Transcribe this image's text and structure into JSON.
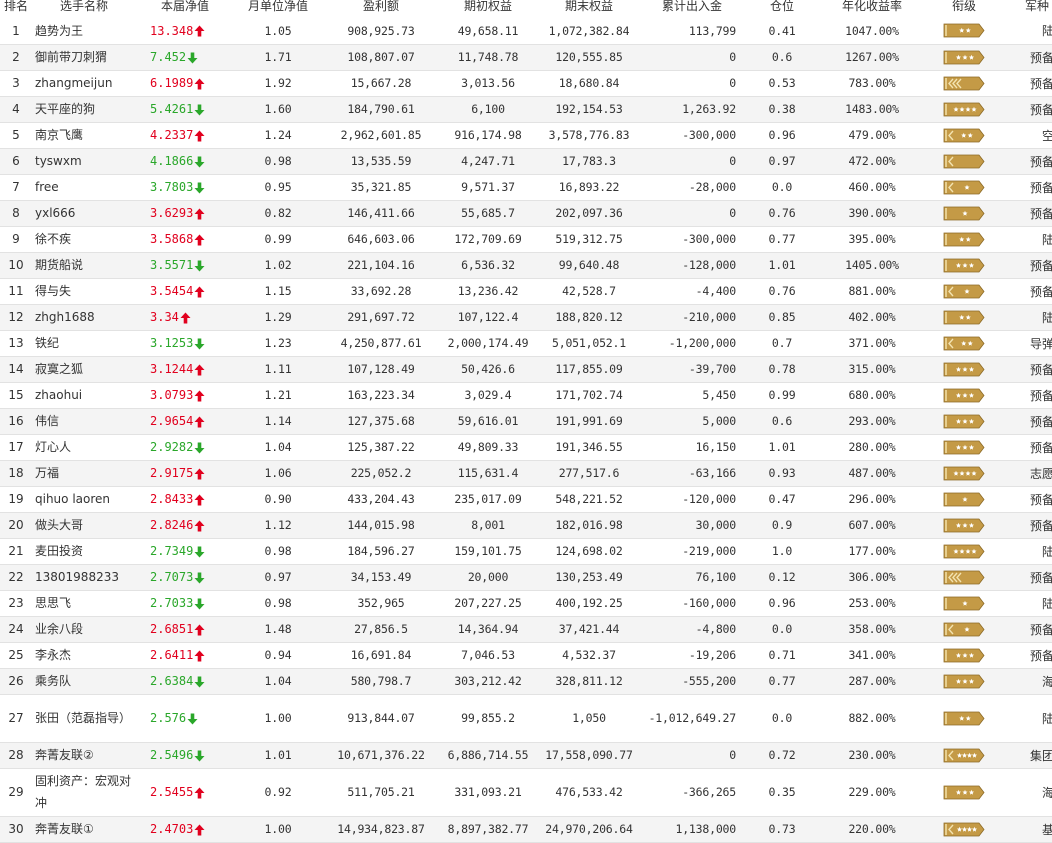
{
  "headers": [
    "排名",
    "选手名称",
    "本届净值",
    "月单位净值",
    "盈利额",
    "期初权益",
    "期末权益",
    "累计出入金",
    "仓位",
    "年化收益率",
    "衔级",
    "军种"
  ],
  "colors": {
    "up": "#e1001e",
    "down": "#2aa72a",
    "badge_fill": "#c49a46",
    "badge_stripe": "#f3e3b0"
  },
  "rows": [
    {
      "rank": "1",
      "name": "趋势为王",
      "net": "13.348",
      "dir": "up",
      "monthly": "1.05",
      "profit": "908,925.73",
      "start": "49,658.11",
      "end": "1,072,382.84",
      "flow": "113,799",
      "position": "0.41",
      "annual": "1047.00%",
      "badge": {
        "style": "stars",
        "count": 2
      },
      "branch": "陆军"
    },
    {
      "rank": "2",
      "name": "御前带刀刺猬",
      "net": "7.452",
      "dir": "down",
      "monthly": "1.71",
      "profit": "108,807.07",
      "start": "11,748.78",
      "end": "120,555.85",
      "flow": "0",
      "position": "0.6",
      "annual": "1267.00%",
      "badge": {
        "style": "stars",
        "count": 3
      },
      "branch": "预备役"
    },
    {
      "rank": "3",
      "name": "zhangmeijun",
      "net": "6.1989",
      "dir": "up",
      "monthly": "1.92",
      "profit": "15,667.28",
      "start": "3,013.56",
      "end": "18,680.84",
      "flow": "0",
      "position": "0.53",
      "annual": "783.00%",
      "badge": {
        "style": "chevrons",
        "count": 3
      },
      "branch": "预备役"
    },
    {
      "rank": "4",
      "name": "天平座的狗",
      "net": "5.4261",
      "dir": "down",
      "monthly": "1.60",
      "profit": "184,790.61",
      "start": "6,100",
      "end": "192,154.53",
      "flow": "1,263.92",
      "position": "0.38",
      "annual": "1483.00%",
      "badge": {
        "style": "stars",
        "count": 4
      },
      "branch": "预备役"
    },
    {
      "rank": "5",
      "name": "南京飞鹰",
      "net": "4.2337",
      "dir": "up",
      "monthly": "1.24",
      "profit": "2,962,601.85",
      "start": "916,174.98",
      "end": "3,578,776.83",
      "flow": "-300,000",
      "position": "0.96",
      "annual": "479.00%",
      "badge": {
        "style": "chevron-stars",
        "count": 2
      },
      "branch": "空军"
    },
    {
      "rank": "6",
      "name": "tyswxm",
      "net": "4.1866",
      "dir": "down",
      "monthly": "0.98",
      "profit": "13,535.59",
      "start": "4,247.71",
      "end": "17,783.3",
      "flow": "0",
      "position": "0.97",
      "annual": "472.00%",
      "badge": {
        "style": "chevrons",
        "count": 1
      },
      "branch": "预备役"
    },
    {
      "rank": "7",
      "name": "free",
      "net": "3.7803",
      "dir": "down",
      "monthly": "0.95",
      "profit": "35,321.85",
      "start": "9,571.37",
      "end": "16,893.22",
      "flow": "-28,000",
      "position": "0.0",
      "annual": "460.00%",
      "badge": {
        "style": "chevron-stars",
        "count": 1
      },
      "branch": "预备役"
    },
    {
      "rank": "8",
      "name": "yxl666",
      "net": "3.6293",
      "dir": "up",
      "monthly": "0.82",
      "profit": "146,411.66",
      "start": "55,685.7",
      "end": "202,097.36",
      "flow": "0",
      "position": "0.76",
      "annual": "390.00%",
      "badge": {
        "style": "stars",
        "count": 1
      },
      "branch": "预备役"
    },
    {
      "rank": "9",
      "name": "徐不疾",
      "net": "3.5868",
      "dir": "up",
      "monthly": "0.99",
      "profit": "646,603.06",
      "start": "172,709.69",
      "end": "519,312.75",
      "flow": "-300,000",
      "position": "0.77",
      "annual": "395.00%",
      "badge": {
        "style": "stars",
        "count": 2
      },
      "branch": "陆军"
    },
    {
      "rank": "10",
      "name": "期货船说",
      "net": "3.5571",
      "dir": "down",
      "monthly": "1.02",
      "profit": "221,104.16",
      "start": "6,536.32",
      "end": "99,640.48",
      "flow": "-128,000",
      "position": "1.01",
      "annual": "1405.00%",
      "badge": {
        "style": "stars",
        "count": 3
      },
      "branch": "预备役"
    },
    {
      "rank": "11",
      "name": "得与失",
      "net": "3.5454",
      "dir": "up",
      "monthly": "1.15",
      "profit": "33,692.28",
      "start": "13,236.42",
      "end": "42,528.7",
      "flow": "-4,400",
      "position": "0.76",
      "annual": "881.00%",
      "badge": {
        "style": "chevron-stars",
        "count": 1
      },
      "branch": "预备役"
    },
    {
      "rank": "12",
      "name": "zhgh1688",
      "net": "3.34",
      "dir": "up",
      "monthly": "1.29",
      "profit": "291,697.72",
      "start": "107,122.4",
      "end": "188,820.12",
      "flow": "-210,000",
      "position": "0.85",
      "annual": "402.00%",
      "badge": {
        "style": "stars",
        "count": 2
      },
      "branch": "陆军"
    },
    {
      "rank": "13",
      "name": "铁纪",
      "net": "3.1253",
      "dir": "down",
      "monthly": "1.23",
      "profit": "4,250,877.61",
      "start": "2,000,174.49",
      "end": "5,051,052.1",
      "flow": "-1,200,000",
      "position": "0.7",
      "annual": "371.00%",
      "badge": {
        "style": "chevron-stars",
        "count": 2
      },
      "branch": "导弹部"
    },
    {
      "rank": "14",
      "name": "寂寞之狐",
      "net": "3.1244",
      "dir": "up",
      "monthly": "1.11",
      "profit": "107,128.49",
      "start": "50,426.6",
      "end": "117,855.09",
      "flow": "-39,700",
      "position": "0.78",
      "annual": "315.00%",
      "badge": {
        "style": "stars",
        "count": 3
      },
      "branch": "预备役"
    },
    {
      "rank": "15",
      "name": "zhaohui",
      "net": "3.0793",
      "dir": "up",
      "monthly": "1.21",
      "profit": "163,223.34",
      "start": "3,029.4",
      "end": "171,702.74",
      "flow": "5,450",
      "position": "0.99",
      "annual": "680.00%",
      "badge": {
        "style": "stars",
        "count": 3
      },
      "branch": "预备役"
    },
    {
      "rank": "16",
      "name": "伟信",
      "net": "2.9654",
      "dir": "up",
      "monthly": "1.14",
      "profit": "127,375.68",
      "start": "59,616.01",
      "end": "191,991.69",
      "flow": "5,000",
      "position": "0.6",
      "annual": "293.00%",
      "badge": {
        "style": "stars",
        "count": 3
      },
      "branch": "预备役"
    },
    {
      "rank": "17",
      "name": "灯心人",
      "net": "2.9282",
      "dir": "down",
      "monthly": "1.04",
      "profit": "125,387.22",
      "start": "49,809.33",
      "end": "191,346.55",
      "flow": "16,150",
      "position": "1.01",
      "annual": "280.00%",
      "badge": {
        "style": "stars",
        "count": 3
      },
      "branch": "预备役"
    },
    {
      "rank": "18",
      "name": "万福",
      "net": "2.9175",
      "dir": "up",
      "monthly": "1.06",
      "profit": "225,052.2",
      "start": "115,631.4",
      "end": "277,517.6",
      "flow": "-63,166",
      "position": "0.93",
      "annual": "487.00%",
      "badge": {
        "style": "stars",
        "count": 4
      },
      "branch": "志愿军"
    },
    {
      "rank": "19",
      "name": "qihuo laoren",
      "net": "2.8433",
      "dir": "up",
      "monthly": "0.90",
      "profit": "433,204.43",
      "start": "235,017.09",
      "end": "548,221.52",
      "flow": "-120,000",
      "position": "0.47",
      "annual": "296.00%",
      "badge": {
        "style": "stars",
        "count": 1
      },
      "branch": "预备役"
    },
    {
      "rank": "20",
      "name": "做头大哥",
      "net": "2.8246",
      "dir": "up",
      "monthly": "1.12",
      "profit": "144,015.98",
      "start": "8,001",
      "end": "182,016.98",
      "flow": "30,000",
      "position": "0.9",
      "annual": "607.00%",
      "badge": {
        "style": "stars",
        "count": 3
      },
      "branch": "预备役"
    },
    {
      "rank": "21",
      "name": "麦田投资",
      "net": "2.7349",
      "dir": "down",
      "monthly": "0.98",
      "profit": "184,596.27",
      "start": "159,101.75",
      "end": "124,698.02",
      "flow": "-219,000",
      "position": "1.0",
      "annual": "177.00%",
      "badge": {
        "style": "stars",
        "count": 4
      },
      "branch": "陆军"
    },
    {
      "rank": "22",
      "name": "13801988233",
      "net": "2.7073",
      "dir": "down",
      "monthly": "0.97",
      "profit": "34,153.49",
      "start": "20,000",
      "end": "130,253.49",
      "flow": "76,100",
      "position": "0.12",
      "annual": "306.00%",
      "badge": {
        "style": "chevrons",
        "count": 3
      },
      "branch": "预备役"
    },
    {
      "rank": "23",
      "name": "思思飞",
      "net": "2.7033",
      "dir": "down",
      "monthly": "0.98",
      "profit": "352,965",
      "start": "207,227.25",
      "end": "400,192.25",
      "flow": "-160,000",
      "position": "0.96",
      "annual": "253.00%",
      "badge": {
        "style": "stars",
        "count": 1
      },
      "branch": "陆军"
    },
    {
      "rank": "24",
      "name": "业余八段",
      "net": "2.6851",
      "dir": "up",
      "monthly": "1.48",
      "profit": "27,856.5",
      "start": "14,364.94",
      "end": "37,421.44",
      "flow": "-4,800",
      "position": "0.0",
      "annual": "358.00%",
      "badge": {
        "style": "chevron-stars",
        "count": 1
      },
      "branch": "预备役"
    },
    {
      "rank": "25",
      "name": "李永杰",
      "net": "2.6411",
      "dir": "up",
      "monthly": "0.94",
      "profit": "16,691.84",
      "start": "7,046.53",
      "end": "4,532.37",
      "flow": "-19,206",
      "position": "0.71",
      "annual": "341.00%",
      "badge": {
        "style": "stars",
        "count": 3
      },
      "branch": "预备役"
    },
    {
      "rank": "26",
      "name": "乘务队",
      "net": "2.6384",
      "dir": "down",
      "monthly": "1.04",
      "profit": "580,798.7",
      "start": "303,212.42",
      "end": "328,811.12",
      "flow": "-555,200",
      "position": "0.77",
      "annual": "287.00%",
      "badge": {
        "style": "stars",
        "count": 3
      },
      "branch": "海军"
    },
    {
      "rank": "27",
      "name": "张田（范磊指导）",
      "net": "2.576",
      "dir": "down",
      "monthly": "1.00",
      "profit": "913,844.07",
      "start": "99,855.2",
      "end": "1,050",
      "flow": "-1,012,649.27",
      "position": "0.0",
      "annual": "882.00%",
      "badge": {
        "style": "stars",
        "count": 2
      },
      "branch": "陆军"
    },
    {
      "rank": "28",
      "name": "奔菁友联②",
      "net": "2.5496",
      "dir": "down",
      "monthly": "1.01",
      "profit": "10,671,376.22",
      "start": "6,886,714.55",
      "end": "17,558,090.77",
      "flow": "0",
      "position": "0.72",
      "annual": "230.00%",
      "badge": {
        "style": "chevron-stars",
        "count": 4
      },
      "branch": "集团军"
    },
    {
      "rank": "29",
      "name": "固利资产：宏观对冲",
      "net": "2.5455",
      "dir": "up",
      "monthly": "0.92",
      "profit": "511,705.21",
      "start": "331,093.21",
      "end": "476,533.42",
      "flow": "-366,265",
      "position": "0.35",
      "annual": "229.00%",
      "badge": {
        "style": "stars",
        "count": 3
      },
      "branch": "海军"
    },
    {
      "rank": "30",
      "name": "奔菁友联①",
      "net": "2.4703",
      "dir": "up",
      "monthly": "1.00",
      "profit": "14,934,823.87",
      "start": "8,897,382.77",
      "end": "24,970,206.64",
      "flow": "1,138,000",
      "position": "0.73",
      "annual": "220.00%",
      "badge": {
        "style": "chevron-stars",
        "count": 4
      },
      "branch": "基金"
    }
  ]
}
